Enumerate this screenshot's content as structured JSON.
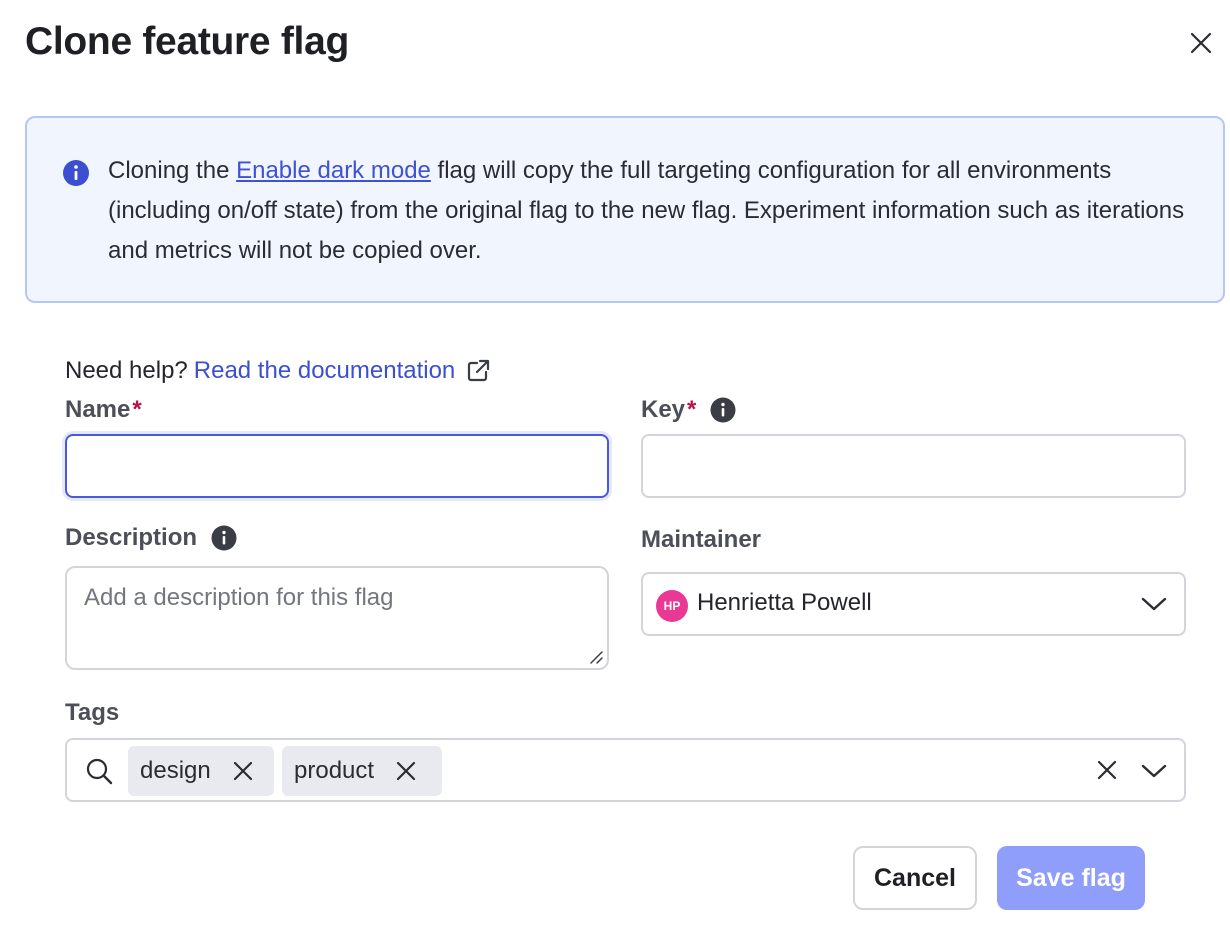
{
  "dialog": {
    "title": "Clone feature flag",
    "close_icon": "close-icon"
  },
  "banner": {
    "icon": "info-circle-icon",
    "text_before": "Cloning the ",
    "link": "Enable dark mode",
    "text_after": " flag will copy the full targeting configuration for all environments (including on/off state) from the original flag to the new flag. Experiment information such as iterations and metrics will not be copied over.",
    "background": "#f1f5fe",
    "border": "#b7c6f3"
  },
  "help": {
    "prefix": "Need help?",
    "link": "Read the documentation",
    "icon": "external-link-icon"
  },
  "fields": {
    "name": {
      "label": "Name",
      "required_mark": "*",
      "value": ""
    },
    "key": {
      "label": "Key",
      "required_mark": "*",
      "value": ""
    },
    "description": {
      "label": "Description",
      "placeholder": "Add a description for this flag",
      "value": ""
    },
    "maintainer": {
      "label": "Maintainer",
      "avatar_initials": "HP",
      "value": "Henrietta Powell"
    },
    "tags": {
      "label": "Tags",
      "items": [
        "design",
        "product"
      ]
    }
  },
  "actions": {
    "cancel": "Cancel",
    "save": "Save flag"
  },
  "colors": {
    "accent": "#4759dc",
    "link": "#3d4fd1",
    "required": "#b5134a",
    "save_disabled": "#8f9dfb",
    "avatar": "#e83a95"
  }
}
